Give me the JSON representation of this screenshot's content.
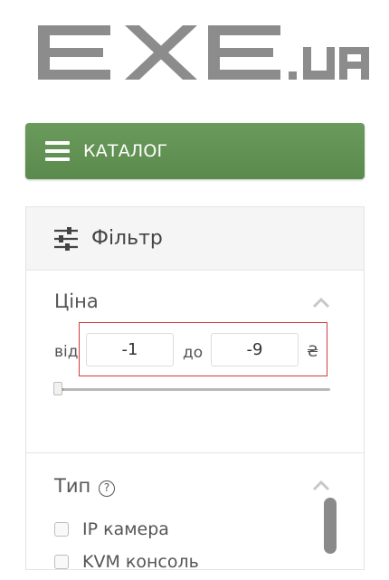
{
  "logo": {
    "text_main": "EXE",
    "text_suffix": ".ua"
  },
  "catalog": {
    "label": "КАТАЛОГ",
    "icon": "hamburger-icon"
  },
  "filter": {
    "title": "Фільтр",
    "icon": "sliders-icon",
    "price": {
      "title": "Ціна",
      "from_label": "від",
      "from_value": "-1",
      "to_label": "до",
      "to_value": "-9",
      "currency": "₴",
      "slider_min_fraction": 0
    },
    "type": {
      "title": "Тип",
      "help_symbol": "?",
      "options": [
        {
          "label": "IP камера",
          "checked": false
        },
        {
          "label": "KVM консоль",
          "checked": false
        }
      ]
    }
  },
  "colors": {
    "accent_green": "#5e8f50",
    "highlight_red": "#d23b3b",
    "logo_gray": "#8c8c8c"
  }
}
